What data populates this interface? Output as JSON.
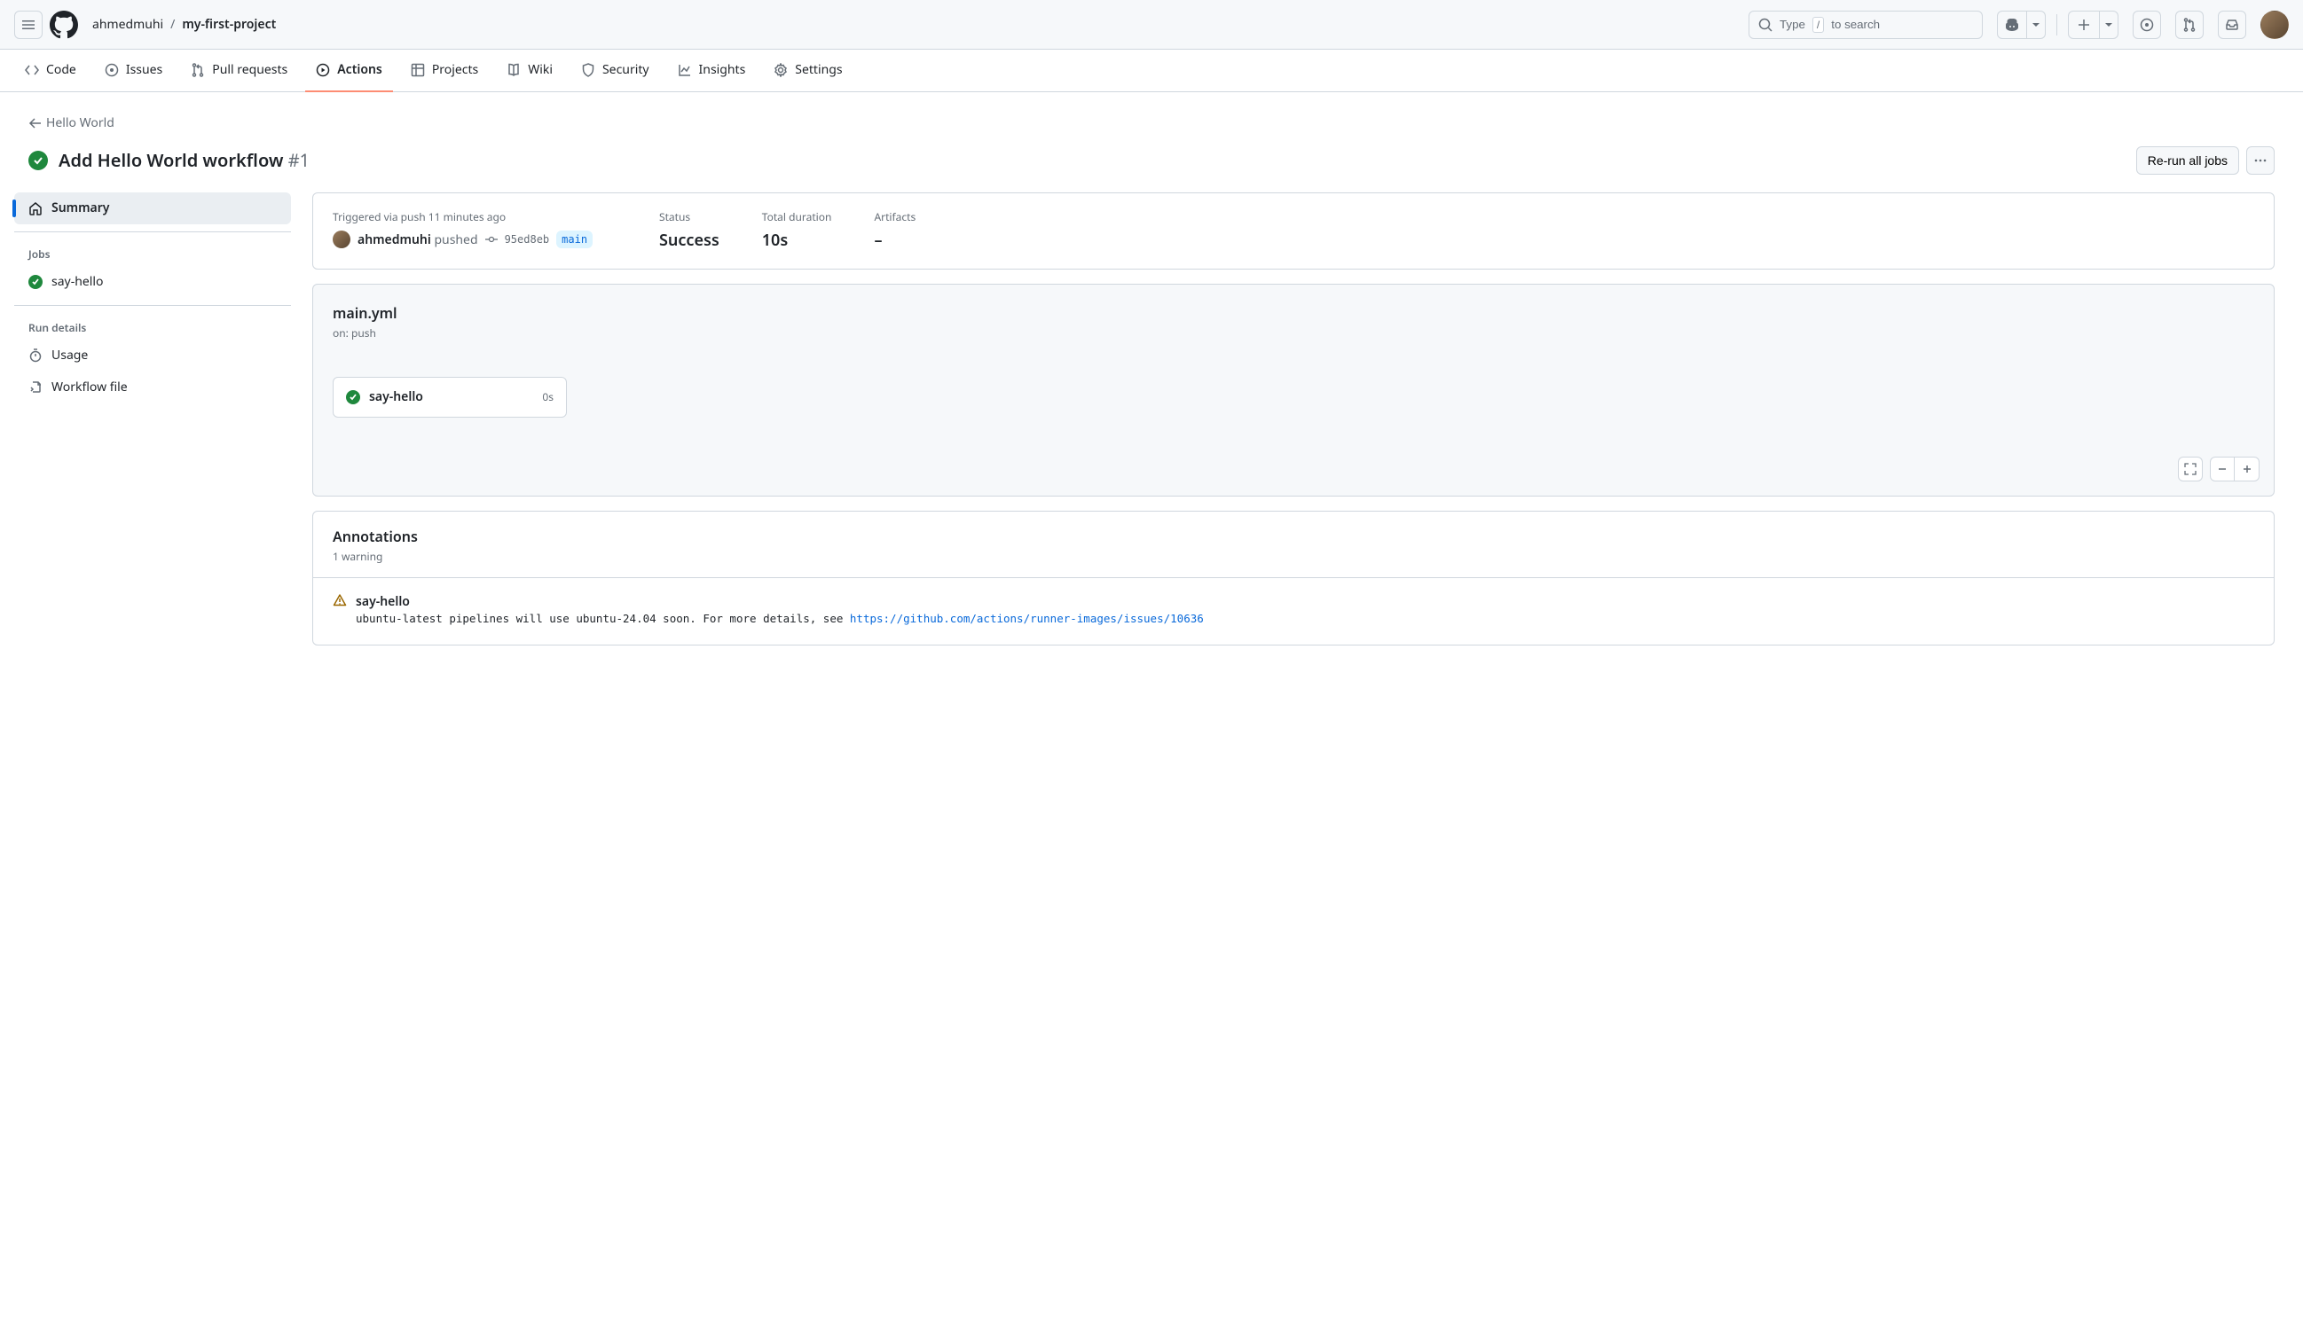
{
  "header": {
    "owner": "ahmedmuhi",
    "repo": "my-first-project",
    "search_prefix": "Type",
    "search_key": "/",
    "search_suffix": "to search"
  },
  "repo_nav": {
    "code": "Code",
    "issues": "Issues",
    "pull_requests": "Pull requests",
    "actions": "Actions",
    "projects": "Projects",
    "wiki": "Wiki",
    "security": "Security",
    "insights": "Insights",
    "settings": "Settings"
  },
  "backlink": "Hello World",
  "run_title": "Add Hello World workflow",
  "run_number": "#1",
  "rerun_label": "Re-run all jobs",
  "sidebar": {
    "summary": "Summary",
    "jobs_label": "Jobs",
    "job1": "say-hello",
    "run_details_label": "Run details",
    "usage": "Usage",
    "workflow_file": "Workflow file"
  },
  "summary": {
    "trigger_line": "Triggered via push 11 minutes ago",
    "user": "ahmedmuhi",
    "verb": "pushed",
    "sha": "95ed8eb",
    "branch": "main",
    "status_label": "Status",
    "status_value": "Success",
    "duration_label": "Total duration",
    "duration_value": "10s",
    "artifacts_label": "Artifacts",
    "artifacts_value": "–"
  },
  "workflow": {
    "file": "main.yml",
    "trigger": "on: push",
    "job_name": "say-hello",
    "job_duration": "0s"
  },
  "annotations": {
    "title": "Annotations",
    "count": "1 warning",
    "job": "say-hello",
    "message": "ubuntu-latest pipelines will use ubuntu-24.04 soon. For more details, see ",
    "link": "https://github.com/actions/runner-images/issues/10636"
  }
}
